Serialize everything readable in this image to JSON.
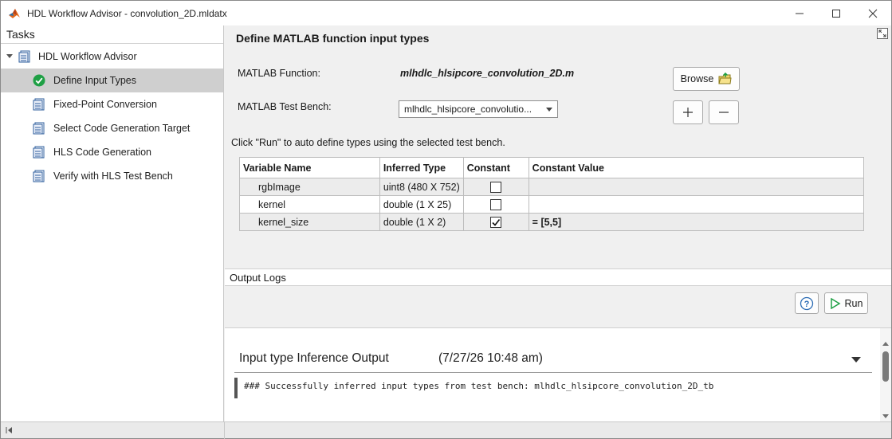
{
  "window": {
    "title": "HDL Workflow Advisor - convolution_2D.mldatx"
  },
  "tasks_panel": {
    "header": "Tasks",
    "root": {
      "label": "HDL Workflow Advisor"
    },
    "items": [
      {
        "label": "Define Input Types",
        "icon": "check-circle-icon",
        "selected": true
      },
      {
        "label": "Fixed-Point Conversion",
        "icon": "task-doc-icon"
      },
      {
        "label": "Select Code Generation Target",
        "icon": "task-doc-icon"
      },
      {
        "label": "HLS Code Generation",
        "icon": "task-doc-icon"
      },
      {
        "label": "Verify with HLS Test Bench",
        "icon": "task-doc-icon"
      }
    ]
  },
  "main": {
    "title": "Define MATLAB function input types",
    "function_label": "MATLAB Function:",
    "function_value": "mlhdlc_hlsipcore_convolution_2D.m",
    "browse_label": "Browse",
    "testbench_label": "MATLAB Test Bench:",
    "testbench_value": "mlhdlc_hlsipcore_convolutio...",
    "hint": "Click \"Run\" to auto define types using the selected test bench.",
    "table": {
      "headers": [
        "Variable Name",
        "Inferred Type",
        "Constant",
        "Constant Value"
      ],
      "rows": [
        {
          "name": "rgbImage",
          "type": "uint8 (480 X 752)",
          "constant": false,
          "value": ""
        },
        {
          "name": "kernel",
          "type": "double (1 X 25)",
          "constant": false,
          "value": ""
        },
        {
          "name": "kernel_size",
          "type": "double (1 X 2)",
          "constant": true,
          "value": "= [5,5]"
        }
      ]
    }
  },
  "output_logs": {
    "header": "Output Logs",
    "run_label": "Run",
    "entry_title": "Input type Inference Output",
    "entry_time": "(7/27/26 10:48 am)",
    "message": "### Successfully inferred input types from test bench: mlhdlc_hlsipcore_convolution_2D_tb"
  },
  "colors": {
    "accent_green": "#1fa045",
    "selected_row": "#cfcfcf"
  }
}
